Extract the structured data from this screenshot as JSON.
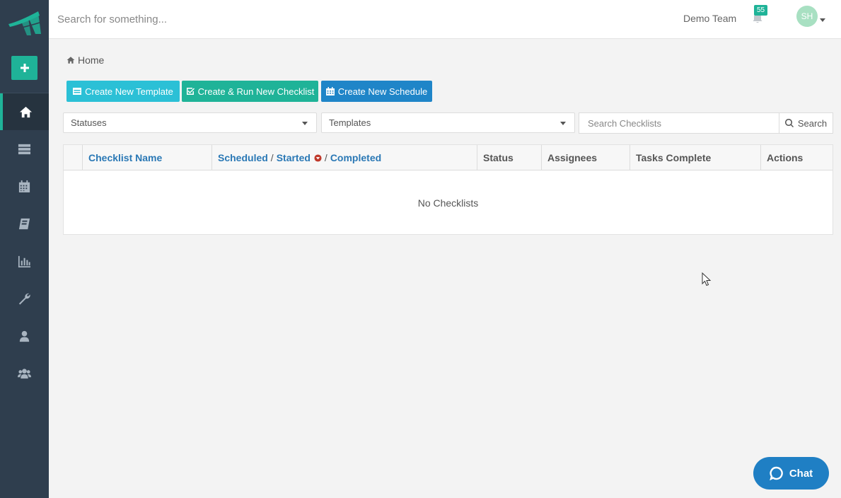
{
  "topbar": {
    "search_placeholder": "Search for something...",
    "team_name": "Demo Team",
    "notification_count": "55",
    "avatar_initials": "SH"
  },
  "sidebar": {
    "items": [
      {
        "icon": "home-icon",
        "active": true
      },
      {
        "icon": "list-icon",
        "active": false
      },
      {
        "icon": "calendar-icon",
        "active": false
      },
      {
        "icon": "book-icon",
        "active": false
      },
      {
        "icon": "bar-chart-icon",
        "active": false
      },
      {
        "icon": "wrench-icon",
        "active": false
      },
      {
        "icon": "user-icon",
        "active": false
      },
      {
        "icon": "users-icon",
        "active": false
      }
    ]
  },
  "breadcrumb": {
    "home_label": "Home"
  },
  "actions": {
    "create_template": "Create New Template",
    "create_run_checklist": "Create & Run New Checklist",
    "create_schedule": "Create New Schedule"
  },
  "filters": {
    "statuses_label": "Statuses",
    "templates_label": "Templates",
    "search_placeholder": "Search Checklists",
    "search_button": "Search"
  },
  "table": {
    "columns": {
      "checklist_name": "Checklist Name",
      "scheduled": "Scheduled",
      "started": "Started",
      "completed": "Completed",
      "status": "Status",
      "assignees": "Assignees",
      "tasks_complete": "Tasks Complete",
      "actions": "Actions"
    },
    "separator": "/",
    "empty_message": "No Checklists"
  },
  "chat": {
    "label": "Chat"
  },
  "colors": {
    "sidebar_bg": "#2f3e4e",
    "accent_green": "#1fb398",
    "accent_cyan": "#2bc0d6",
    "accent_blue": "#1f85c8",
    "link_blue": "#2a78b5",
    "sort_red": "#c0392b"
  }
}
